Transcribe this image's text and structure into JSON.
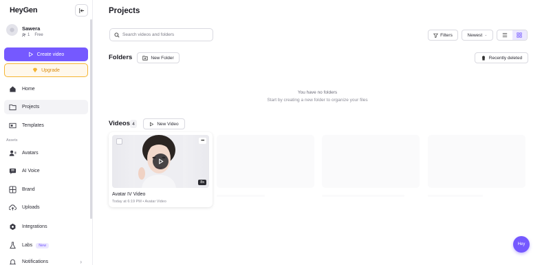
{
  "sidebar": {
    "logo": "HeyGen",
    "user": {
      "name": "Sawera",
      "seats": "1",
      "plan": "Free"
    },
    "create_label": "Create video",
    "upgrade_label": "Upgrade",
    "assets_label": "Assets",
    "items": [
      {
        "label": "Home",
        "icon": "home-icon"
      },
      {
        "label": "Projects",
        "icon": "folder-icon"
      },
      {
        "label": "Templates",
        "icon": "template-icon"
      },
      {
        "label": "Avatars",
        "icon": "avatar-icon"
      },
      {
        "label": "AI Voice",
        "icon": "voice-icon"
      },
      {
        "label": "Brand",
        "icon": "brand-icon"
      },
      {
        "label": "Uploads",
        "icon": "upload-icon"
      },
      {
        "label": "Integrations",
        "icon": "integrations-icon"
      },
      {
        "label": "Labs",
        "icon": "labs-icon",
        "badge": "New"
      },
      {
        "label": "Notifications",
        "icon": "bell-icon"
      }
    ]
  },
  "main": {
    "title": "Projects",
    "search_placeholder": "Search videos and folders",
    "filters_label": "Filters",
    "sort_label": "Newest",
    "folders_heading": "Folders",
    "new_folder_label": "New Folder",
    "recently_deleted_label": "Recently deleted",
    "empty_title": "You have no folders",
    "empty_subtitle": "Start by creating a new folder to organize your files",
    "videos_heading": "Videos",
    "videos_count": "4",
    "new_video_label": "New Video",
    "videos": [
      {
        "title": "Avatar IV Video",
        "meta": "Today at 6:19 PM • Avatar Video",
        "duration": "8s"
      }
    ]
  },
  "chat_button": "Hey",
  "colors": {
    "accent": "#7559ff",
    "upgrade": "#f5b431"
  }
}
